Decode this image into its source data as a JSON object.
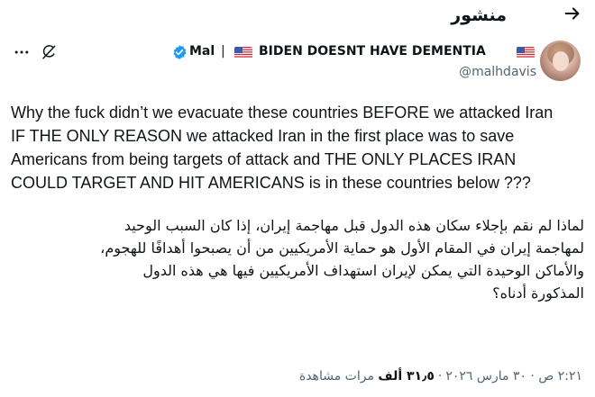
{
  "header": {
    "title": "منشور"
  },
  "author": {
    "display_name_part1": "Mal",
    "separator": "|",
    "display_name_part2": "BIDEN DOESNT HAVE DEMENTIA",
    "handle": "@malhdavis"
  },
  "tweet": {
    "text_en": "Why the fuck didn’t we evacuate these countries BEFORE we attacked Iran\nIF THE ONLY REASON we attacked Iran in the first place was to save\nAmericans from being targets of attack and THE ONLY PLACES IRAN\nCOULD TARGET AND HIT AMERICANS is in these countries below ???",
    "text_ar": "لماذا لم نقم بإجلاء سكان هذه الدول قبل مهاجمة إيران، إذا كان السبب الوحيد\nلمهاجمة إيران في المقام الأول هو حماية الأمريكيين من أن يصبحوا أهدافًا للهجوم،\nوالأماكن الوحيدة التي يمكن لإيران استهداف الأمريكيين فيها هي هذه الدول\nالمذكورة أدناه؟"
  },
  "meta": {
    "time_date": "٢:٢١ ص · ٣٠ مارس ٢٠٢٦",
    "views_count": "٣١٫٥ ألف",
    "views_label": "مرات مشاهدة"
  },
  "icons": {
    "back": "arrow-right-icon",
    "more": "more-horizontal-icon",
    "grok": "grok-icon",
    "verified": "verified-badge-icon",
    "flag": "us-flag-icon"
  },
  "colors": {
    "verified_blue": "#1d9bf0",
    "secondary_text": "#536471",
    "primary_text": "#0f1419"
  }
}
